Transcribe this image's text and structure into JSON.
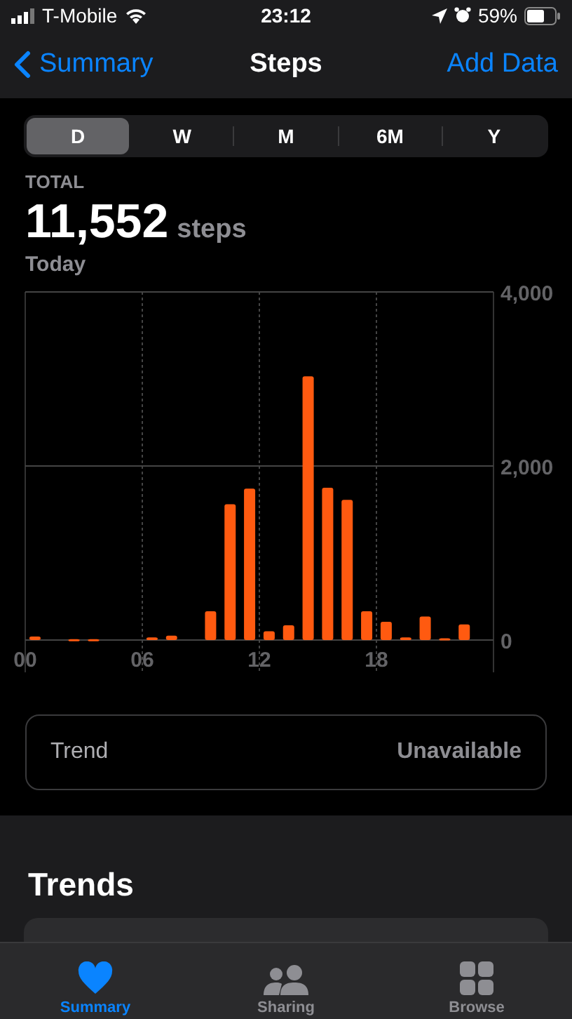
{
  "status_bar": {
    "carrier": "T-Mobile",
    "time": "23:12",
    "battery": "59%"
  },
  "nav": {
    "back": "Summary",
    "title": "Steps",
    "action": "Add Data"
  },
  "range_tabs": [
    {
      "label": "D",
      "selected": true
    },
    {
      "label": "W",
      "selected": false
    },
    {
      "label": "M",
      "selected": false
    },
    {
      "label": "6M",
      "selected": false
    },
    {
      "label": "Y",
      "selected": false
    }
  ],
  "summary": {
    "label": "TOTAL",
    "value": "11,552",
    "unit": "steps",
    "period": "Today"
  },
  "chart_data": {
    "type": "bar",
    "x": [
      0.5,
      2.5,
      3.5,
      6.5,
      7.5,
      9.5,
      10.5,
      11.5,
      12.5,
      13.5,
      14.5,
      15.5,
      16.5,
      17.5,
      18.5,
      19.5,
      20.5,
      21.5,
      22.5
    ],
    "xlim": [
      0,
      24
    ],
    "grid": true,
    "ref_lines": [
      {
        "axis": "y",
        "value": 2000
      }
    ],
    "series": [
      {
        "color": "#ff5a10",
        "values": [
          40,
          10,
          10,
          30,
          50,
          330,
          1560,
          1740,
          100,
          170,
          3030,
          1750,
          1610,
          330,
          210,
          30,
          270,
          20,
          180
        ]
      }
    ],
    "ylim": [
      0,
      4000
    ],
    "yticks": [
      {
        "value": 0,
        "label": "0"
      },
      {
        "value": 2000,
        "label": "2,000"
      },
      {
        "value": 4000,
        "label": "4,000"
      }
    ],
    "xticks": [
      {
        "value": 0,
        "label": "00"
      },
      {
        "value": 6,
        "label": "06"
      },
      {
        "value": 12,
        "label": "12"
      },
      {
        "value": 18,
        "label": "18"
      }
    ]
  },
  "trend": {
    "label": "Trend",
    "value": "Unavailable"
  },
  "trends": {
    "heading": "Trends"
  },
  "tab_bar": [
    {
      "label": "Summary",
      "kind": "heart",
      "selected": true
    },
    {
      "label": "Sharing",
      "kind": "people",
      "selected": false
    },
    {
      "label": "Browse",
      "kind": "grid",
      "selected": false
    }
  ]
}
